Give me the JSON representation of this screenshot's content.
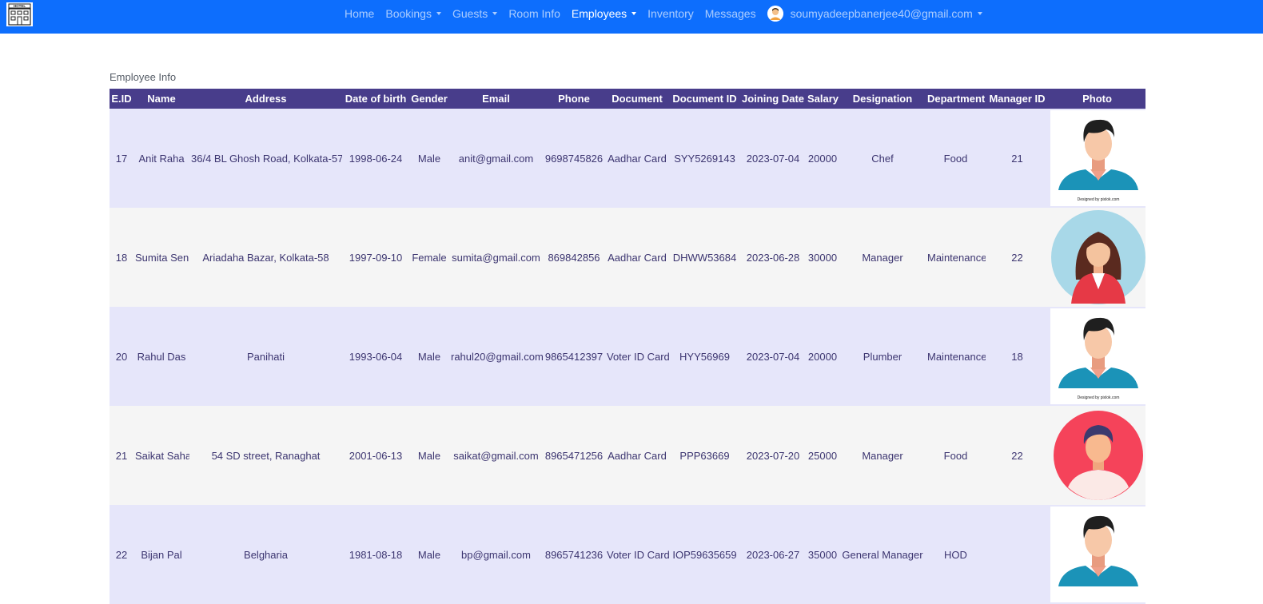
{
  "nav": {
    "items": [
      {
        "label": "Home",
        "dropdown": false,
        "active": false
      },
      {
        "label": "Bookings",
        "dropdown": true,
        "active": false
      },
      {
        "label": "Guests",
        "dropdown": true,
        "active": false
      },
      {
        "label": "Room Info",
        "dropdown": false,
        "active": false
      },
      {
        "label": "Employees",
        "dropdown": true,
        "active": true
      },
      {
        "label": "Inventory",
        "dropdown": false,
        "active": false
      },
      {
        "label": "Messages",
        "dropdown": false,
        "active": false
      }
    ],
    "user_email": "soumyadeepbanerjee40@gmail.com",
    "brand_icon": "hotel-icon"
  },
  "page": {
    "section_title": "Employee Info"
  },
  "table": {
    "headers": [
      "E.ID",
      "Name",
      "Address",
      "Date of birth",
      "Gender",
      "Email",
      "Phone",
      "Document",
      "Document ID",
      "Joining Date",
      "Salary",
      "Designation",
      "Department",
      "Manager ID",
      "Photo"
    ],
    "rows": [
      {
        "eid": "17",
        "name": "Anit Raha",
        "address": "36/4 BL Ghosh Road, Kolkata-57",
        "dob": "1998-06-24",
        "gender": "Male",
        "email": "anit@gmail.com",
        "phone": "9698745826",
        "document": "Aadhar Card",
        "document_id": "SYY5269143",
        "joining_date": "2023-07-04",
        "salary": "20000",
        "designation": "Chef",
        "department": "Food",
        "manager_id": "21",
        "photo": "male-avatar-icon",
        "photo_caption": "Designed by pixlok.com"
      },
      {
        "eid": "18",
        "name": "Sumita Sen",
        "address": "Ariadaha Bazar, Kolkata-58",
        "dob": "1997-09-10",
        "gender": "Female",
        "email": "sumita@gmail.com",
        "phone": "869842856",
        "document": "Aadhar Card",
        "document_id": "DHWW53684",
        "joining_date": "2023-06-28",
        "salary": "30000",
        "designation": "Manager",
        "department": "Maintenance",
        "manager_id": "22",
        "photo": "female-avatar-icon",
        "photo_caption": ""
      },
      {
        "eid": "20",
        "name": "Rahul Das",
        "address": "Panihati",
        "dob": "1993-06-04",
        "gender": "Male",
        "email": "rahul20@gmail.com",
        "phone": "9865412397",
        "document": "Voter ID Card",
        "document_id": "HYY56969",
        "joining_date": "2023-07-04",
        "salary": "20000",
        "designation": "Plumber",
        "department": "Maintenance",
        "manager_id": "18",
        "photo": "male-avatar-icon",
        "photo_caption": "Designed by pixlok.com"
      },
      {
        "eid": "21",
        "name": "Saikat Saha",
        "address": "54 SD street, Ranaghat",
        "dob": "2001-06-13",
        "gender": "Male",
        "email": "saikat@gmail.com",
        "phone": "8965471256",
        "document": "Aadhar Card",
        "document_id": "PPP63669",
        "joining_date": "2023-07-20",
        "salary": "25000",
        "designation": "Manager",
        "department": "Food",
        "manager_id": "22",
        "photo": "male-round-avatar-icon",
        "photo_caption": ""
      },
      {
        "eid": "22",
        "name": "Bijan Pal",
        "address": "Belgharia",
        "dob": "1981-08-18",
        "gender": "Male",
        "email": "bp@gmail.com",
        "phone": "8965741236",
        "document": "Voter ID Card",
        "document_id": "IOP59635659",
        "joining_date": "2023-06-27",
        "salary": "35000",
        "designation": "General Manager",
        "department": "HOD",
        "manager_id": "",
        "photo": "male-avatar-icon",
        "photo_caption": ""
      }
    ]
  },
  "colors": {
    "navbar": "#0d6efd",
    "table_header": "#483d8b",
    "row_odd": "#e6e6fa",
    "row_even": "#f5f5f5",
    "cell_text": "#3c3570"
  }
}
